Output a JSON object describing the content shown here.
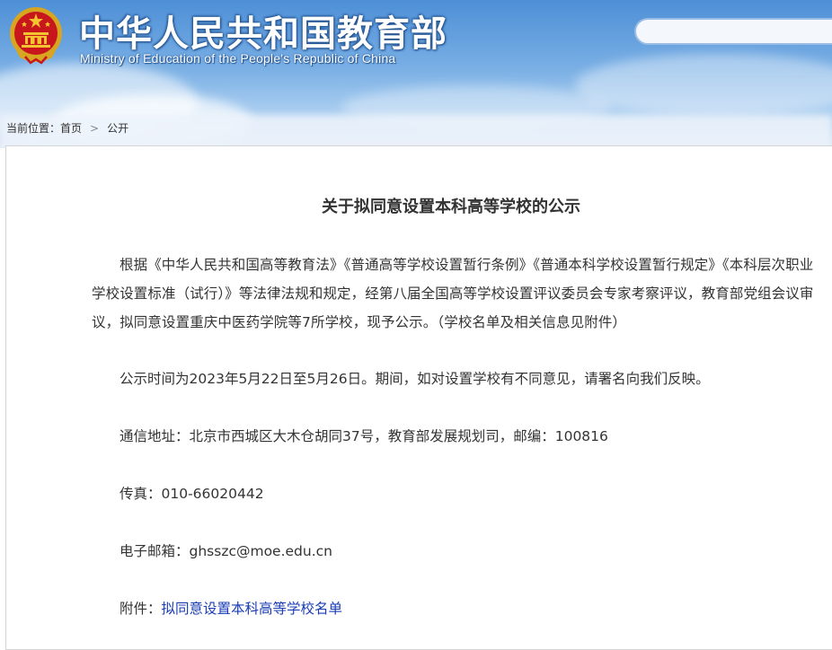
{
  "header": {
    "title": "中华人民共和国教育部",
    "subtitle": "Ministry of Education of the People's Republic of China",
    "emblem_icon": "national-emblem-icon"
  },
  "breadcrumb": {
    "prefix": "当前位置：",
    "home": "首页",
    "separator": ">",
    "current": "公开"
  },
  "article": {
    "title": "关于拟同意设置本科高等学校的公示",
    "paragraph1": "根据《中华人民共和国高等教育法》《普通高等学校设置暂行条例》《普通本科学校设置暂行规定》《本科层次职业学校设置标准（试行）》等法律法规和规定，经第八届全国高等学校设置评议委员会专家考察评议，教育部党组会议审议，拟同意设置重庆中医药学院等7所学校，现予公示。（学校名单及相关信息见附件）",
    "paragraph2": "公示时间为2023年5月22日至5月26日。期间，如对设置学校有不同意见，请署名向我们反映。",
    "address": "通信地址：北京市西城区大木仓胡同37号，教育部发展规划司，邮编：100816",
    "fax": "传真：010-66020442",
    "email": "电子邮箱：ghsszc@moe.edu.cn",
    "attachment_label": "附件：",
    "attachment_link": "拟同意设置本科高等学校名单"
  },
  "colors": {
    "link": "#1a3db5",
    "header_blue": "#4d8fd6"
  }
}
